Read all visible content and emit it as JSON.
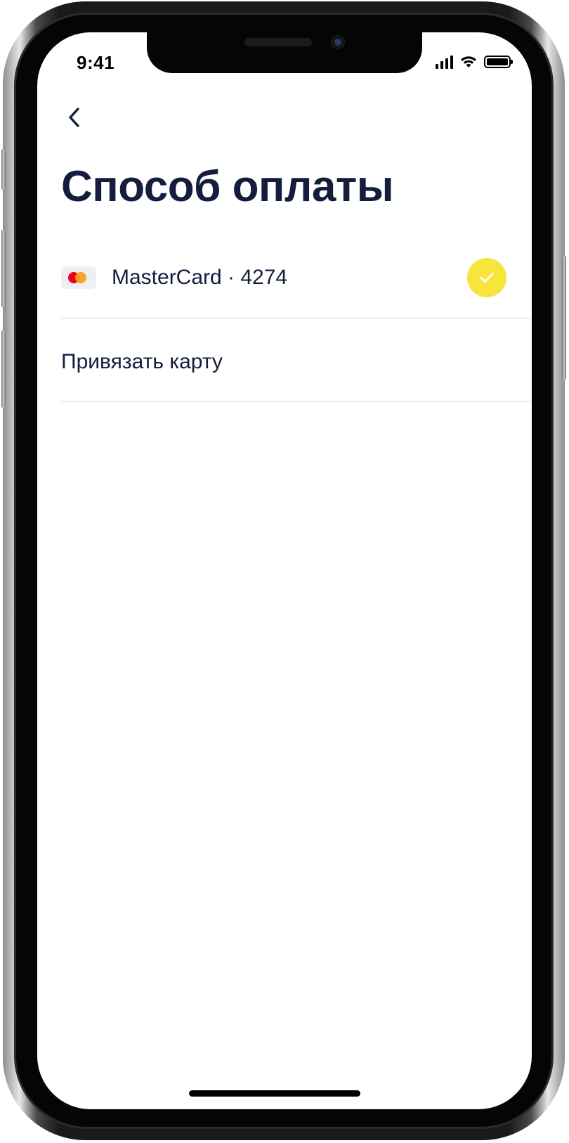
{
  "status_bar": {
    "time": "9:41"
  },
  "header": {
    "back_icon": "chevron-left-icon",
    "title": "Способ оплаты"
  },
  "payment_methods": [
    {
      "label": "MasterCard · 4274",
      "icon": "mastercard-icon",
      "selected": true,
      "selected_icon": "checkmark-icon"
    }
  ],
  "add_card": {
    "label": "Привязать карту"
  },
  "colors": {
    "text_primary": "#141d3d",
    "accent_yellow": "#f8e53c",
    "divider": "#ededed",
    "mastercard_red": "#eb001b",
    "mastercard_orange": "#f79e1b"
  }
}
